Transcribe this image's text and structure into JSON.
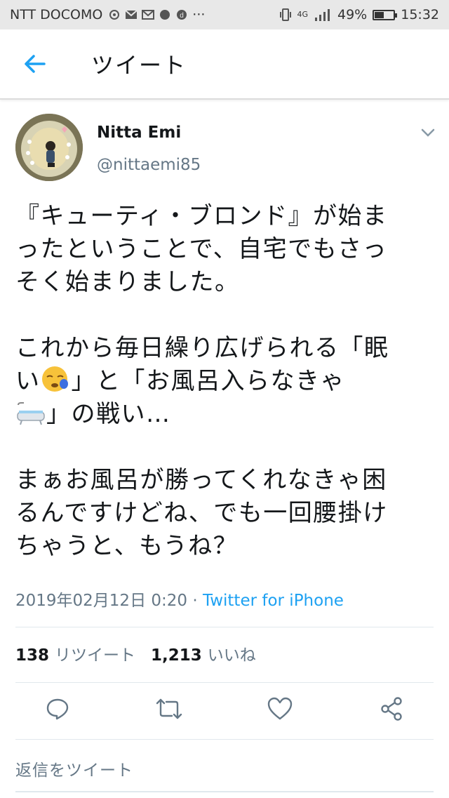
{
  "status_bar": {
    "carrier": "NTT DOCOMO",
    "network": "4G",
    "battery": "49%",
    "battery_level": 0.49,
    "time": "15:32"
  },
  "header": {
    "title": "ツイート",
    "back_icon": "arrow-left-icon"
  },
  "tweet": {
    "author_name": "Nitta Emi",
    "author_handle": "@nittaemi85",
    "lines": [
      "『キューティ・ブロンド』が始ま",
      "ったということで、自宅でもさっ",
      "そく始まりました。",
      "",
      "これから毎日繰り広げられる「眠",
      "い",
      "」と「お風呂入らなきゃ",
      "」の戦い…",
      "",
      "まぁお風呂が勝ってくれなきゃ困",
      "るんですけどね、でも一回腰掛け",
      "ちゃうと、もうね？"
    ],
    "timestamp": "2019年02月12日 0:20",
    "separator": " · ",
    "source": "Twitter for iPhone",
    "retweet_count": "138",
    "retweet_label": "リツイート",
    "like_count": "1,213",
    "like_label": "いいね"
  },
  "actions": {
    "reply_icon": "reply-icon",
    "retweet_icon": "retweet-icon",
    "like_icon": "heart-icon",
    "share_icon": "share-icon"
  },
  "reply_placeholder": "返信をツイート",
  "colors": {
    "accent": "#1da1f2",
    "secondary_text": "#657786",
    "primary_text": "#14171a"
  }
}
